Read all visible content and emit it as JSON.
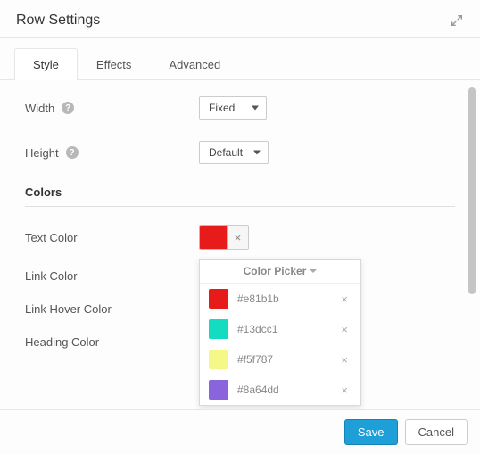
{
  "header": {
    "title": "Row Settings"
  },
  "tabs": [
    {
      "label": "Style",
      "active": true
    },
    {
      "label": "Effects",
      "active": false
    },
    {
      "label": "Advanced",
      "active": false
    }
  ],
  "fields": {
    "width": {
      "label": "Width",
      "value": "Fixed"
    },
    "height": {
      "label": "Height",
      "value": "Default"
    }
  },
  "section": {
    "colors_title": "Colors"
  },
  "color_fields": {
    "text": {
      "label": "Text Color",
      "value": "#e81b1b"
    },
    "link": {
      "label": "Link Color"
    },
    "link_hover": {
      "label": "Link Hover Color"
    },
    "heading": {
      "label": "Heading Color"
    }
  },
  "picker": {
    "title": "Color Picker",
    "presets": [
      {
        "hex": "#e81b1b"
      },
      {
        "hex": "#13dcc1"
      },
      {
        "hex": "#f5f787"
      },
      {
        "hex": "#8a64dd"
      }
    ]
  },
  "footer": {
    "save": "Save",
    "cancel": "Cancel"
  }
}
